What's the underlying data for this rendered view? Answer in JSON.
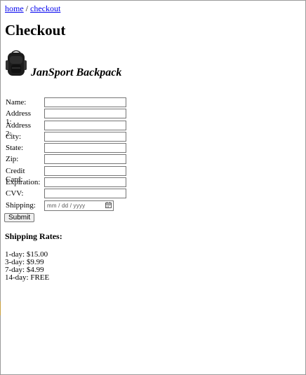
{
  "breadcrumb": {
    "home": "home",
    "separator": "/",
    "checkout": "checkout"
  },
  "page": {
    "title": "Checkout"
  },
  "product": {
    "name": "JanSport Backpack",
    "image_icon": "backpack-icon"
  },
  "form": {
    "fields": [
      {
        "label": "Name:",
        "value": ""
      },
      {
        "label": "Address 1:",
        "value": ""
      },
      {
        "label": "Address 2:",
        "value": ""
      },
      {
        "label": "City:",
        "value": ""
      },
      {
        "label": "State:",
        "value": ""
      },
      {
        "label": "Zip:",
        "value": ""
      },
      {
        "label": "Credit Card:",
        "value": ""
      },
      {
        "label": "Expiration:",
        "value": ""
      },
      {
        "label": "CVV:",
        "value": ""
      }
    ],
    "shipping_label": "Shipping:",
    "shipping_placeholder": "mm / dd / yyyy",
    "submit_label": "Submit"
  },
  "shipping_rates": {
    "title": "Shipping Rates:",
    "rates": [
      "1-day: $15.00",
      "3-day: $9.99",
      "7-day: $4.99",
      "14-day: FREE"
    ]
  },
  "colors": {
    "link": "#0000ee",
    "input_border": "#767676",
    "button_bg": "#efefef"
  }
}
